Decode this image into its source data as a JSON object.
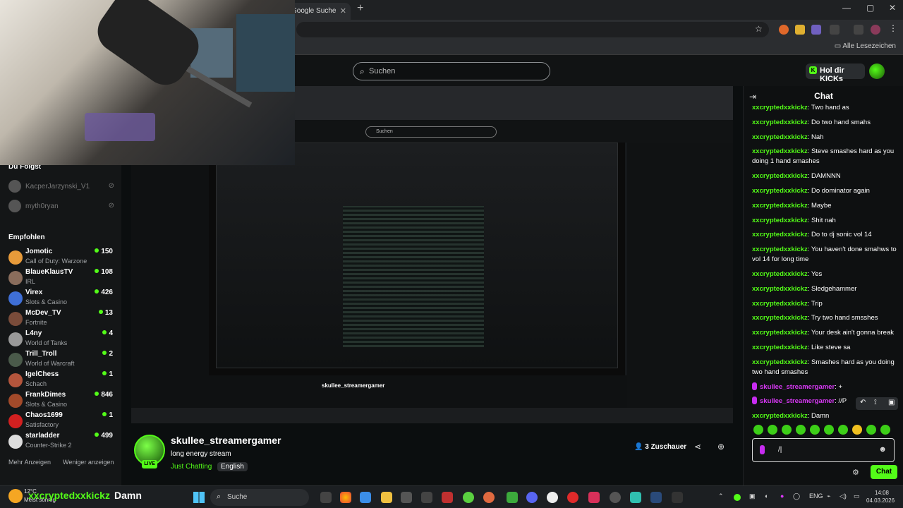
{
  "browser": {
    "tab_title": "Google Suche",
    "bookmarks_label": "Alle Lesezeichen"
  },
  "kick": {
    "search_placeholder": "Suchen",
    "get_kicks": "Hol dir KICKs"
  },
  "sidebar": {
    "following_title": "Du Folgst",
    "following": [
      {
        "name": "KacperJarzynski_V1"
      },
      {
        "name": "myth0ryan"
      }
    ],
    "recommended_title": "Empfohlen",
    "recommended": [
      {
        "name": "Jomotic",
        "game": "Call of Duty: Warzone",
        "viewers": "150",
        "color": "#e89b3a"
      },
      {
        "name": "BlaueKlausTV",
        "game": "IRL",
        "viewers": "108",
        "color": "#8a6d5c"
      },
      {
        "name": "Virex",
        "game": "Slots & Casino",
        "viewers": "426",
        "color": "#3f6fd6"
      },
      {
        "name": "McDev_TV",
        "game": "Fortnite",
        "viewers": "13",
        "color": "#7a4c3a"
      },
      {
        "name": "L4ny",
        "game": "World of Tanks",
        "viewers": "4",
        "color": "#999999"
      },
      {
        "name": "Trill_Troll",
        "game": "World of Warcraft",
        "viewers": "2",
        "color": "#4a5a4a"
      },
      {
        "name": "IgelChess",
        "game": "Schach",
        "viewers": "1",
        "color": "#b4553c"
      },
      {
        "name": "FrankDimes",
        "game": "Slots & Casino",
        "viewers": "846",
        "color": "#a34a2a"
      },
      {
        "name": "Chaos1699",
        "game": "Satisfactory",
        "viewers": "1",
        "color": "#d22020"
      },
      {
        "name": "starladder",
        "game": "Counter-Strike 2",
        "viewers": "499",
        "color": "#dddddd"
      }
    ],
    "show_more": "Mehr Anzeigen",
    "show_less": "Weniger anzeigen"
  },
  "stream": {
    "streamer": "skullee_streamergamer",
    "title": "long energy stream",
    "category": "Just Chatting",
    "language": "English",
    "live": "LIVE",
    "viewers": "3",
    "viewers_label": "Zuschauer"
  },
  "chat": {
    "header": "Chat",
    "messages": [
      {
        "user": "xxcryptedxxkickz",
        "text": "Two hand as",
        "pink": false
      },
      {
        "user": "xxcryptedxxkickz",
        "text": "Do two hand smahs",
        "pink": false
      },
      {
        "user": "xxcryptedxxkickz",
        "text": "Nah",
        "pink": false
      },
      {
        "user": "xxcryptedxxkickz",
        "text": "Steve smashes hard as you doing 1 hand smashes",
        "pink": false
      },
      {
        "user": "xxcryptedxxkickz",
        "text": "DAMNNN",
        "pink": false
      },
      {
        "user": "xxcryptedxxkickz",
        "text": "Do dominator again",
        "pink": false
      },
      {
        "user": "xxcryptedxxkickz",
        "text": "Maybe",
        "pink": false
      },
      {
        "user": "xxcryptedxxkickz",
        "text": "Shit nah",
        "pink": false
      },
      {
        "user": "xxcryptedxxkickz",
        "text": "Do to dj sonic vol 14",
        "pink": false
      },
      {
        "user": "xxcryptedxxkickz",
        "text": "You haven't done smahws to vol 14 for long time",
        "pink": false
      },
      {
        "user": "xxcryptedxxkickz",
        "text": "Yes",
        "pink": false
      },
      {
        "user": "xxcryptedxxkickz",
        "text": "Sledgehammer",
        "pink": false
      },
      {
        "user": "xxcryptedxxkickz",
        "text": "Trip",
        "pink": false
      },
      {
        "user": "xxcryptedxxkickz",
        "text": "Try two hand smsshes",
        "pink": false
      },
      {
        "user": "xxcryptedxxkickz",
        "text": "Your desk ain't gonna break",
        "pink": false
      },
      {
        "user": "xxcryptedxxkickz",
        "text": "Like steve sa",
        "pink": false
      },
      {
        "user": "xxcryptedxxkickz",
        "text": "Smashes hard as you doing two hand smashes",
        "pink": false
      },
      {
        "user": "skullee_streamergamer",
        "text": "+",
        "pink": true
      },
      {
        "user": "skullee_streamergamer",
        "text": "//P",
        "pink": true
      },
      {
        "user": "xxcryptedxxkickz",
        "text": "Damn",
        "pink": false
      }
    ],
    "input_value": "/|",
    "send_label": "Chat"
  },
  "overlay": {
    "user": "xxcryptedxxkickz",
    "text": "Damn"
  },
  "taskbar": {
    "temp": "12°C",
    "weather": "Meist sonnig",
    "search": "Suche",
    "lang": "ENG",
    "time": "14:08",
    "date": "04.03.2026"
  },
  "colors": {
    "accent": "#53fc18",
    "mod": "#d838f5",
    "bg": "#0b0e0f"
  }
}
